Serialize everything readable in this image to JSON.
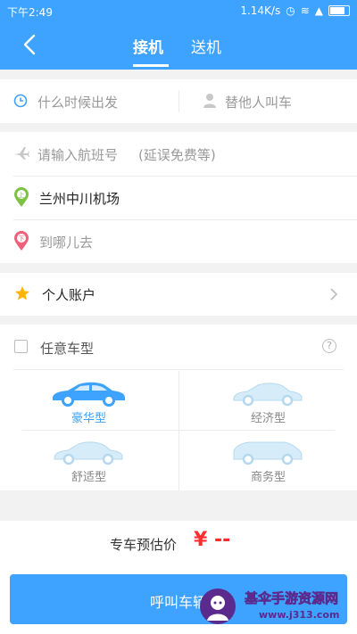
{
  "status": {
    "time": "下午2:49",
    "speed": "1.14K/s"
  },
  "nav": {
    "tab_pickup": "接机",
    "tab_dropoff": "送机"
  },
  "top_row": {
    "time_placeholder": "什么时候出发",
    "other_placeholder": "替他人叫车"
  },
  "trip": {
    "flight_placeholder": "请输入航班号",
    "flight_hint": "(延误免费等)",
    "from_marker": "上",
    "from_value": "兰州中川机场",
    "to_marker": "下",
    "to_placeholder": "到哪儿去"
  },
  "account": {
    "label": "个人账户"
  },
  "cars": {
    "any_label": "任意车型",
    "help": "?",
    "types": [
      {
        "label": "豪华型",
        "selected": true
      },
      {
        "label": "经济型",
        "selected": false
      },
      {
        "label": "舒适型",
        "selected": false
      },
      {
        "label": "商务型",
        "selected": false
      }
    ]
  },
  "estimate": {
    "label": "专车预估价",
    "value": "¥ --"
  },
  "call_button": "呼叫车辆",
  "watermark": {
    "text": "基伞手游资源网",
    "url": "www.j313.com"
  },
  "colors": {
    "accent": "#3ea2ff",
    "price": "#ff2d2d",
    "star": "#ffb400",
    "from": "#7dc243",
    "to": "#f0607a"
  }
}
